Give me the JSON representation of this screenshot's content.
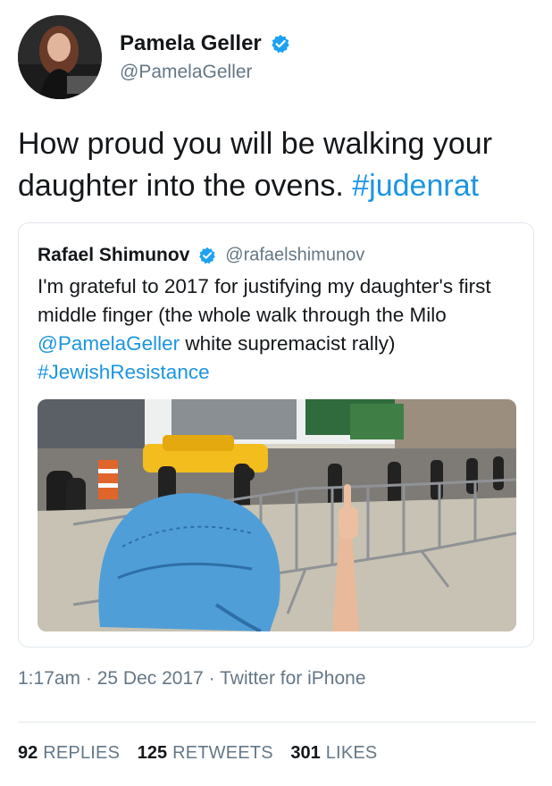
{
  "author": {
    "name": "Pamela Geller",
    "handle": "@PamelaGeller",
    "verified_color": "#1da1f2"
  },
  "tweet": {
    "text": "How proud you will be walking your daughter into the ovens. ",
    "hashtag": "#judenrat"
  },
  "quoted": {
    "name": "Rafael Shimunov",
    "handle": "@rafaelshimunov",
    "text_part1": "I'm grateful to 2017 for justifying my daughter's first middle finger (the whole walk through the Milo ",
    "mention": "@PamelaGeller",
    "text_part2": " white supremacist rally) ",
    "hashtag": "#JewishResistance",
    "photo_alt": "Child in blue bandana raising middle finger at street barricades"
  },
  "meta": {
    "time": "1:17am",
    "date": "25 Dec 2017",
    "source": "Twitter for iPhone",
    "separator": " · "
  },
  "stats": {
    "replies_count": "92",
    "replies_label": "REPLIES",
    "retweets_count": "125",
    "retweets_label": "RETWEETS",
    "likes_count": "301",
    "likes_label": "LIKES"
  }
}
